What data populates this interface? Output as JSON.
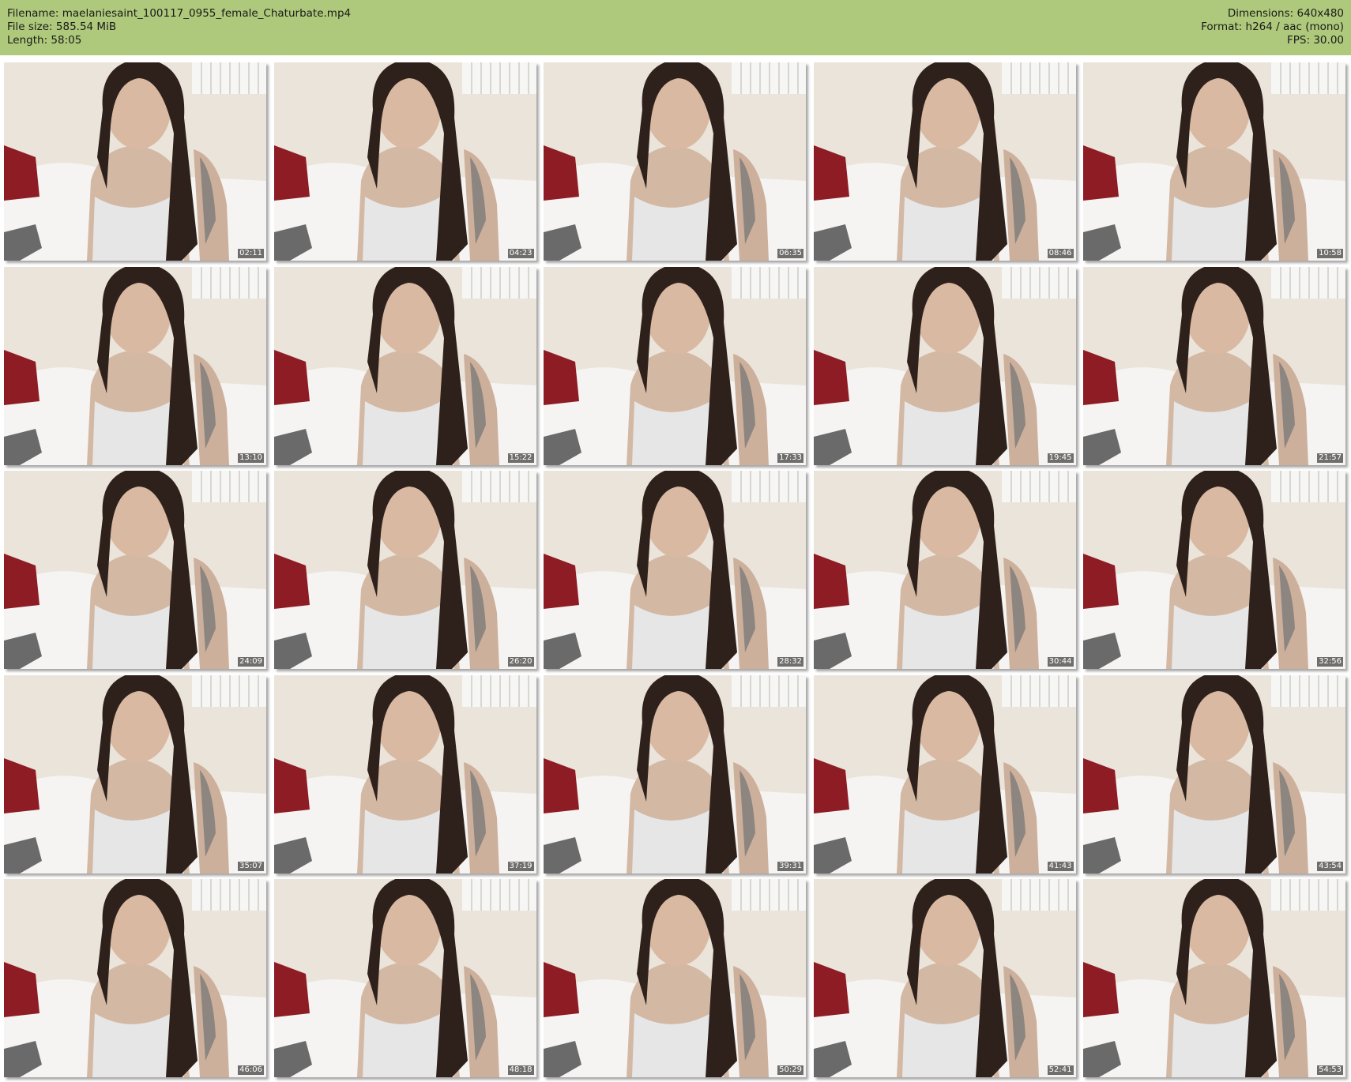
{
  "header": {
    "filename_line": "Filename: maelaniesaint_100117_0955_female_Chaturbate.mp4",
    "filesize_line": "File size: 585.54 MiB",
    "length_line": "Length: 58:05",
    "dimensions_line": "Dimensions: 640x480",
    "format_line": "Format: h264 / aac (mono)",
    "fps_line": "FPS: 30.00"
  },
  "colors": {
    "header_bg": "#aec97b",
    "timestamp_bg": "#000000",
    "timestamp_text": "#ffffff"
  },
  "thumbnails": [
    {
      "time": "02:11"
    },
    {
      "time": "04:23"
    },
    {
      "time": "06:35"
    },
    {
      "time": "08:46"
    },
    {
      "time": "10:58"
    },
    {
      "time": "13:10"
    },
    {
      "time": "15:22"
    },
    {
      "time": "17:33"
    },
    {
      "time": "19:45"
    },
    {
      "time": "21:57"
    },
    {
      "time": "24:09"
    },
    {
      "time": "26:20"
    },
    {
      "time": "28:32"
    },
    {
      "time": "30:44"
    },
    {
      "time": "32:56"
    },
    {
      "time": "35:07"
    },
    {
      "time": "37:19"
    },
    {
      "time": "39:31"
    },
    {
      "time": "41:43"
    },
    {
      "time": "43:54"
    },
    {
      "time": "46:06"
    },
    {
      "time": "48:18"
    },
    {
      "time": "50:29"
    },
    {
      "time": "52:41"
    },
    {
      "time": "54:53"
    }
  ]
}
